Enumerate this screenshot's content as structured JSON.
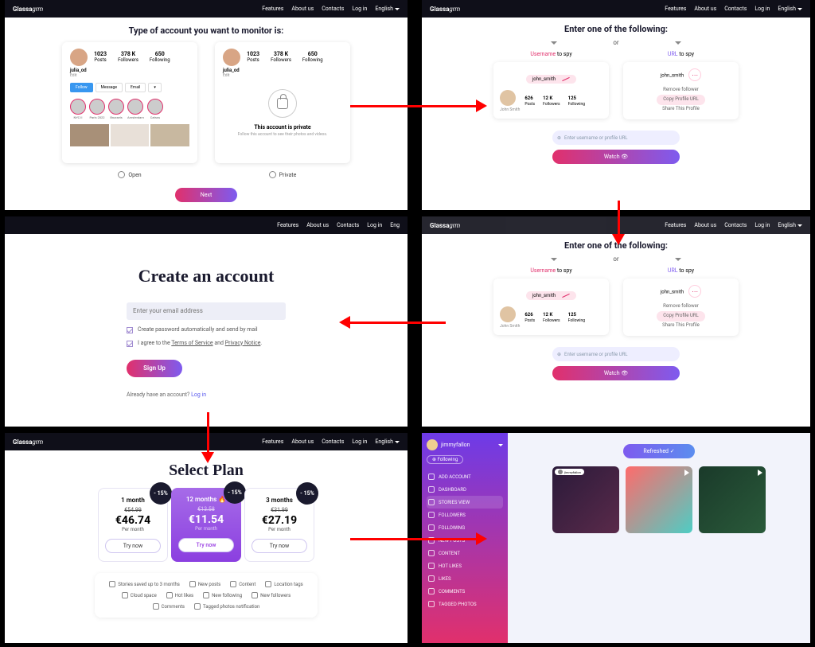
{
  "brand": {
    "g": "Glassa",
    "grm": "grm"
  },
  "nav": {
    "features": "Features",
    "about": "About us",
    "contacts": "Contacts",
    "login": "Log in",
    "english": "English"
  },
  "step1": {
    "title": "Type of account you want to monitor is:",
    "user": "julia_od",
    "sub": "Edit",
    "posts": "1023",
    "posts_l": "Posts",
    "followers": "378 K",
    "followers_l": "Followers",
    "following": "650",
    "following_l": "Following",
    "follow": "Follow",
    "message": "Message",
    "email": "Email",
    "story_l1": "NYC II",
    "story_l2": "Paris 2022",
    "story_l3": "Brussels",
    "story_l4": "Amsterdam",
    "story_l5": "Catsss",
    "priv_user": "julia_od",
    "priv_title": "This account is private",
    "priv_sub": "Follow this account to see their photos and videos.",
    "open": "Open",
    "private": "Private",
    "next": "Next"
  },
  "step2": {
    "title": "Enter one of the following:",
    "or": "or",
    "uname_hdr_u": "Username",
    "uname_hdr_s": " to spy",
    "url_hdr_u": "URL",
    "url_hdr_s": " to spy",
    "handle": "john_smith",
    "name": "John Smith",
    "posts": "626",
    "posts_l": "Posts",
    "followers": "12 K",
    "followers_l": "Followers",
    "following": "125",
    "following_l": "Following",
    "remove": "Remove follower",
    "copy": "Copy Profile URL",
    "share": "Share This Profile",
    "placeholder": "Enter username or profile URL",
    "watch": "Watch 👁"
  },
  "step3": {
    "title": "Create an account",
    "email_ph": "Enter your email address",
    "check1": "Create password automatically and send by mail",
    "check2_a": "I agree to the ",
    "check2_b": "Terms of Service",
    "check2_c": " and ",
    "check2_d": "Privacy Notice",
    "check2_e": ".",
    "signup": "Sign Up",
    "already": "Already have an account?  ",
    "login": "Log in"
  },
  "step4": {
    "title": "Select Plan",
    "badge": "- 15%",
    "plans": [
      {
        "name": "1 month",
        "old": "€54.99",
        "price": "€46.74",
        "per": "Per month",
        "try": "Try now"
      },
      {
        "name": "12 months",
        "fire": "🔥",
        "old": "€13.58",
        "price": "€11.54",
        "per": "Per month",
        "try": "Try now"
      },
      {
        "name": "3 months",
        "old": "€31.99",
        "price": "€27.19",
        "per": "Per month",
        "try": "Try now"
      }
    ],
    "features": [
      "Stories saved up to 3 months",
      "New posts",
      "Content",
      "Location tags",
      "Cloud space",
      "Hot likes",
      "New following",
      "New followers",
      "Comments",
      "Tagged photos notification"
    ]
  },
  "dash": {
    "user": "jimmyfallon",
    "following_badge": "⊕ Following",
    "menu": [
      "ADD ACCOUNT",
      "DASHBOARD",
      "STORIES VIEW",
      "FOLLOWERS",
      "FOLLOWING",
      "NEW POSTS",
      "CONTENT",
      "HOT LIKES",
      "LIKES",
      "COMMENTS",
      "TAGGED PHOTOS"
    ],
    "refresh": "Refreshed ✓",
    "post_caption": "jimmyfallon"
  }
}
